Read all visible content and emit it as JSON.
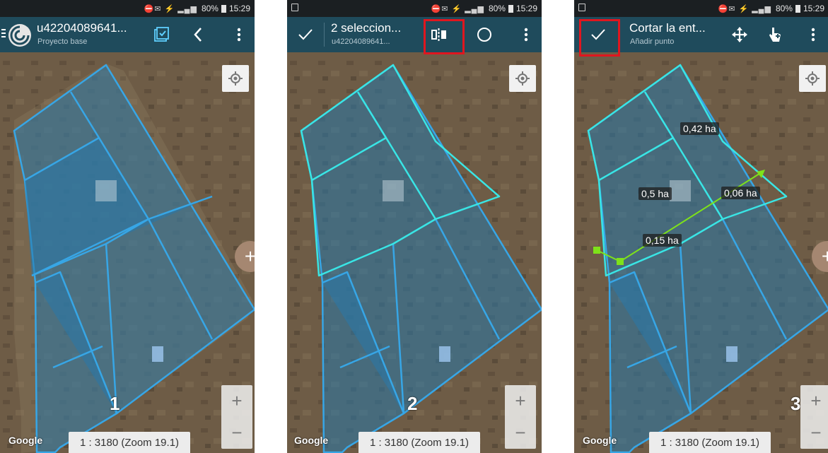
{
  "panels": [
    {
      "number": "1",
      "status": {
        "icons": "⛔✉ ⚡ ▂▄▆",
        "battery": "80%",
        "time": "15:29"
      },
      "toolbar": {
        "title": "u42204089641...",
        "subtitle": "Proyecto base"
      },
      "scale_label": "1 : 3180 (Zoom 19.1)",
      "google_label": "Google"
    },
    {
      "number": "2",
      "status": {
        "icons": "⛔✉ ⚡ ▂▄▆",
        "battery": "80%",
        "time": "15:29"
      },
      "toolbar": {
        "title": "2 seleccion...",
        "subtitle": "u42204089641..."
      },
      "scale_label": "1 : 3180 (Zoom 19.1)",
      "google_label": "Google"
    },
    {
      "number": "3",
      "status": {
        "icons": "⛔✉ ⚡ ▂▄▆",
        "battery": "80%",
        "time": "15:29"
      },
      "toolbar": {
        "title": "Cortar la ent...",
        "subtitle": "Añadir punto"
      },
      "scale_label": "1 : 3180 (Zoom 19.1)",
      "google_label": "Google",
      "area_labels": [
        "0,42 ha",
        "0,5 ha",
        "0,06 ha",
        "0,15 ha"
      ]
    }
  ],
  "colors": {
    "toolbar": "#1f4b5c",
    "parcel_outline": "#37a6e6",
    "selected_outline": "#39e5e5",
    "cut_line": "#7ee21a",
    "highlight": "#e0161f"
  },
  "icons": {
    "menu": "hamburger-icon",
    "logo": "app-logo-icon",
    "select": "select-checkbox-icon",
    "back": "chevron-left-icon",
    "more": "more-vert-icon",
    "confirm": "check-icon",
    "split": "split-icon",
    "circle": "circle-icon",
    "move": "move-icon",
    "add_point": "add-point-icon",
    "locate": "gps-icon"
  }
}
